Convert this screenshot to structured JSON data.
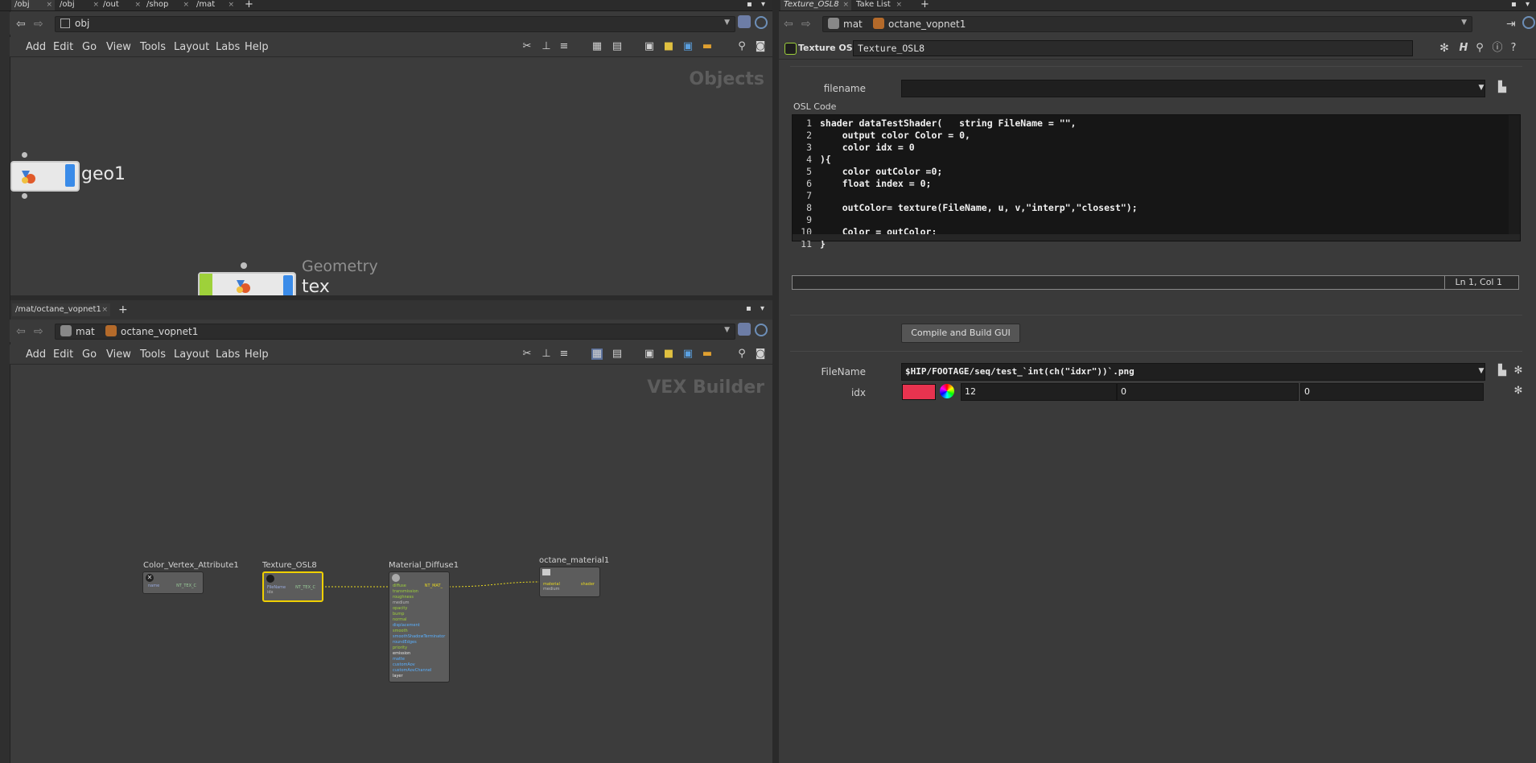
{
  "top_tabs": [
    {
      "label": "/obj"
    },
    {
      "label": "/obj"
    },
    {
      "label": "/out"
    },
    {
      "label": "/shop"
    },
    {
      "label": "/mat"
    }
  ],
  "top_path": {
    "value": "obj"
  },
  "menu": [
    "Add",
    "Edit",
    "Go",
    "View",
    "Tools",
    "Layout",
    "Labs",
    "Help"
  ],
  "objects_pane": {
    "title": "Objects",
    "node_geo1": "geo1",
    "node_tex_type": "Geometry",
    "node_tex": "tex"
  },
  "bottom_tab": {
    "label": "/mat/octane_vopnet1"
  },
  "bottom_path": {
    "mat": "mat",
    "vopnet": "octane_vopnet1"
  },
  "vex_pane": {
    "title": "VEX Builder",
    "nodes": {
      "color_vertex": {
        "title": "Color_Vertex_Attribute1",
        "in_label": "name",
        "out_label": "NT_TEX_C"
      },
      "texture_osl": {
        "title": "Texture_OSL8",
        "in_label1": "FileName",
        "in_label2": "idx",
        "out_label": "NT_TEX_C"
      },
      "material_diffuse": {
        "title": "Material_Diffuse1",
        "out_label": "NT_MAT_",
        "inputs": [
          "diffuse",
          "transmission",
          "roughness",
          "medium",
          "opacity",
          "bump",
          "normal",
          "displacement",
          "smooth",
          "smoothShadowTerminator",
          "roundEdges",
          "priority",
          "emission",
          "matte",
          "customAov",
          "customAovChannel",
          "layer"
        ]
      },
      "octane_material": {
        "title": "octane_material1",
        "in_label1": "material",
        "in_label2": "medium",
        "out_label": "shader"
      }
    }
  },
  "right_tabs": [
    {
      "label": "Texture_OSL8"
    },
    {
      "label": "Take List"
    }
  ],
  "right_path": {
    "mat": "mat",
    "vopnet": "octane_vopnet1"
  },
  "param_header": {
    "type": "Texture OSL",
    "name": "Texture_OSL8"
  },
  "params": {
    "filename_label": "filename",
    "filename_value": "",
    "osl_code_label": "OSL Code",
    "code_lines": [
      "shader dataTestShader(   string FileName = \"\",",
      "    output color Color = 0,",
      "    color idx = 0",
      "){",
      "    color outColor =0;",
      "    float index = 0;",
      "",
      "    outColor= texture(FileName, u, v,\"interp\",\"closest\");",
      "",
      "    Color = outColor;",
      "}"
    ],
    "line_numbers": [
      "1",
      "2",
      "3",
      "4",
      "5",
      "6",
      "7",
      "8",
      "9",
      "10",
      "11"
    ],
    "cursor_pos": "Ln 1, Col 1",
    "compile_button": "Compile and Build GUI",
    "filename2_label": "FileName",
    "filename2_value": "$HIP/FOOTAGE/seq/test_`int(ch(\"idxr\"))`.png",
    "idx_label": "idx",
    "idx_color": "#e8334f",
    "idx_values": [
      "12",
      "0",
      "0"
    ]
  }
}
